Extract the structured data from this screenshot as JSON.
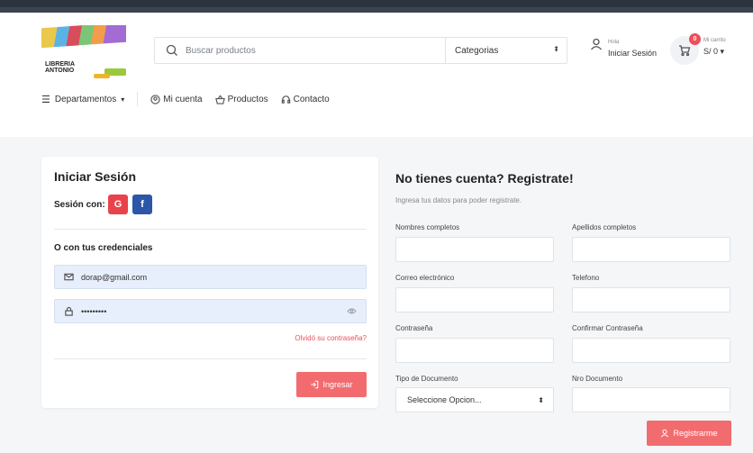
{
  "brand": {
    "line1": "LIBRERIA",
    "line2": "ANTONIO"
  },
  "search": {
    "placeholder": "Buscar productos",
    "category": "Categorias"
  },
  "account": {
    "greeting": "Hola",
    "login": "Iniciar Sesión"
  },
  "cart": {
    "label": "Mi carrito",
    "count": "0",
    "total": "S/ 0"
  },
  "nav": {
    "departments": "Departamentos",
    "account": "Mi cuenta",
    "products": "Productos",
    "contact": "Contacto"
  },
  "login_card": {
    "title": "Iniciar Sesión",
    "social_label": "Sesión con:",
    "google": "G",
    "facebook": "f",
    "credentials_label": "O con tus credenciales",
    "email_value": "dorap@gmail.com",
    "password_value": "•••••••••",
    "forgot": "Olvidó su contraseña?",
    "submit": "Ingresar"
  },
  "register": {
    "title": "No tienes cuenta? Registrate!",
    "subtitle": "Ingresa tus datos para poder registrate.",
    "labels": {
      "first_name": "Nombres completos",
      "last_name": "Apellidos completos",
      "email": "Correo electrónico",
      "phone": "Telefono",
      "password": "Contraseña",
      "confirm": "Confirmar Contraseña",
      "doc_type": "Tipo de Documento",
      "doc_number": "Nro Documento"
    },
    "doc_type_value": "Seleccione Opcion...",
    "submit": "Registrarme"
  },
  "colors": {
    "accent": "#f26c6f",
    "badge": "#ef4d5a",
    "google": "#e8434b",
    "facebook": "#2c57a8",
    "field_bg": "#e8effc"
  }
}
